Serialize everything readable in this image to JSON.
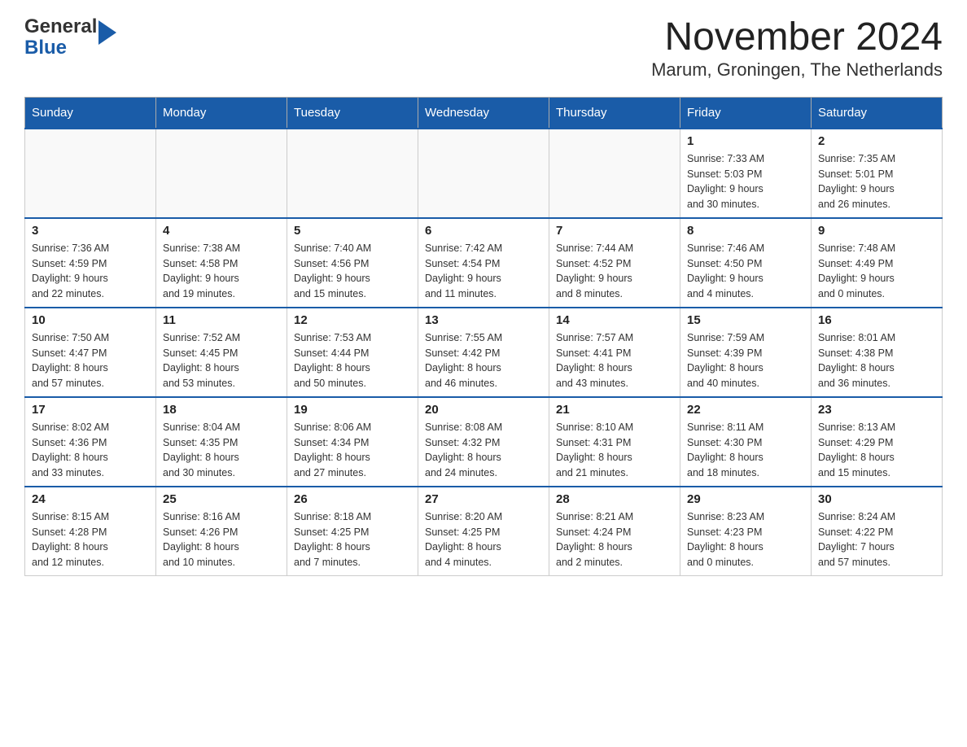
{
  "header": {
    "logo_general": "General",
    "logo_blue": "Blue",
    "month_title": "November 2024",
    "location": "Marum, Groningen, The Netherlands"
  },
  "days_of_week": [
    "Sunday",
    "Monday",
    "Tuesday",
    "Wednesday",
    "Thursday",
    "Friday",
    "Saturday"
  ],
  "weeks": [
    [
      {
        "day": "",
        "info": ""
      },
      {
        "day": "",
        "info": ""
      },
      {
        "day": "",
        "info": ""
      },
      {
        "day": "",
        "info": ""
      },
      {
        "day": "",
        "info": ""
      },
      {
        "day": "1",
        "info": "Sunrise: 7:33 AM\nSunset: 5:03 PM\nDaylight: 9 hours\nand 30 minutes."
      },
      {
        "day": "2",
        "info": "Sunrise: 7:35 AM\nSunset: 5:01 PM\nDaylight: 9 hours\nand 26 minutes."
      }
    ],
    [
      {
        "day": "3",
        "info": "Sunrise: 7:36 AM\nSunset: 4:59 PM\nDaylight: 9 hours\nand 22 minutes."
      },
      {
        "day": "4",
        "info": "Sunrise: 7:38 AM\nSunset: 4:58 PM\nDaylight: 9 hours\nand 19 minutes."
      },
      {
        "day": "5",
        "info": "Sunrise: 7:40 AM\nSunset: 4:56 PM\nDaylight: 9 hours\nand 15 minutes."
      },
      {
        "day": "6",
        "info": "Sunrise: 7:42 AM\nSunset: 4:54 PM\nDaylight: 9 hours\nand 11 minutes."
      },
      {
        "day": "7",
        "info": "Sunrise: 7:44 AM\nSunset: 4:52 PM\nDaylight: 9 hours\nand 8 minutes."
      },
      {
        "day": "8",
        "info": "Sunrise: 7:46 AM\nSunset: 4:50 PM\nDaylight: 9 hours\nand 4 minutes."
      },
      {
        "day": "9",
        "info": "Sunrise: 7:48 AM\nSunset: 4:49 PM\nDaylight: 9 hours\nand 0 minutes."
      }
    ],
    [
      {
        "day": "10",
        "info": "Sunrise: 7:50 AM\nSunset: 4:47 PM\nDaylight: 8 hours\nand 57 minutes."
      },
      {
        "day": "11",
        "info": "Sunrise: 7:52 AM\nSunset: 4:45 PM\nDaylight: 8 hours\nand 53 minutes."
      },
      {
        "day": "12",
        "info": "Sunrise: 7:53 AM\nSunset: 4:44 PM\nDaylight: 8 hours\nand 50 minutes."
      },
      {
        "day": "13",
        "info": "Sunrise: 7:55 AM\nSunset: 4:42 PM\nDaylight: 8 hours\nand 46 minutes."
      },
      {
        "day": "14",
        "info": "Sunrise: 7:57 AM\nSunset: 4:41 PM\nDaylight: 8 hours\nand 43 minutes."
      },
      {
        "day": "15",
        "info": "Sunrise: 7:59 AM\nSunset: 4:39 PM\nDaylight: 8 hours\nand 40 minutes."
      },
      {
        "day": "16",
        "info": "Sunrise: 8:01 AM\nSunset: 4:38 PM\nDaylight: 8 hours\nand 36 minutes."
      }
    ],
    [
      {
        "day": "17",
        "info": "Sunrise: 8:02 AM\nSunset: 4:36 PM\nDaylight: 8 hours\nand 33 minutes."
      },
      {
        "day": "18",
        "info": "Sunrise: 8:04 AM\nSunset: 4:35 PM\nDaylight: 8 hours\nand 30 minutes."
      },
      {
        "day": "19",
        "info": "Sunrise: 8:06 AM\nSunset: 4:34 PM\nDaylight: 8 hours\nand 27 minutes."
      },
      {
        "day": "20",
        "info": "Sunrise: 8:08 AM\nSunset: 4:32 PM\nDaylight: 8 hours\nand 24 minutes."
      },
      {
        "day": "21",
        "info": "Sunrise: 8:10 AM\nSunset: 4:31 PM\nDaylight: 8 hours\nand 21 minutes."
      },
      {
        "day": "22",
        "info": "Sunrise: 8:11 AM\nSunset: 4:30 PM\nDaylight: 8 hours\nand 18 minutes."
      },
      {
        "day": "23",
        "info": "Sunrise: 8:13 AM\nSunset: 4:29 PM\nDaylight: 8 hours\nand 15 minutes."
      }
    ],
    [
      {
        "day": "24",
        "info": "Sunrise: 8:15 AM\nSunset: 4:28 PM\nDaylight: 8 hours\nand 12 minutes."
      },
      {
        "day": "25",
        "info": "Sunrise: 8:16 AM\nSunset: 4:26 PM\nDaylight: 8 hours\nand 10 minutes."
      },
      {
        "day": "26",
        "info": "Sunrise: 8:18 AM\nSunset: 4:25 PM\nDaylight: 8 hours\nand 7 minutes."
      },
      {
        "day": "27",
        "info": "Sunrise: 8:20 AM\nSunset: 4:25 PM\nDaylight: 8 hours\nand 4 minutes."
      },
      {
        "day": "28",
        "info": "Sunrise: 8:21 AM\nSunset: 4:24 PM\nDaylight: 8 hours\nand 2 minutes."
      },
      {
        "day": "29",
        "info": "Sunrise: 8:23 AM\nSunset: 4:23 PM\nDaylight: 8 hours\nand 0 minutes."
      },
      {
        "day": "30",
        "info": "Sunrise: 8:24 AM\nSunset: 4:22 PM\nDaylight: 7 hours\nand 57 minutes."
      }
    ]
  ]
}
